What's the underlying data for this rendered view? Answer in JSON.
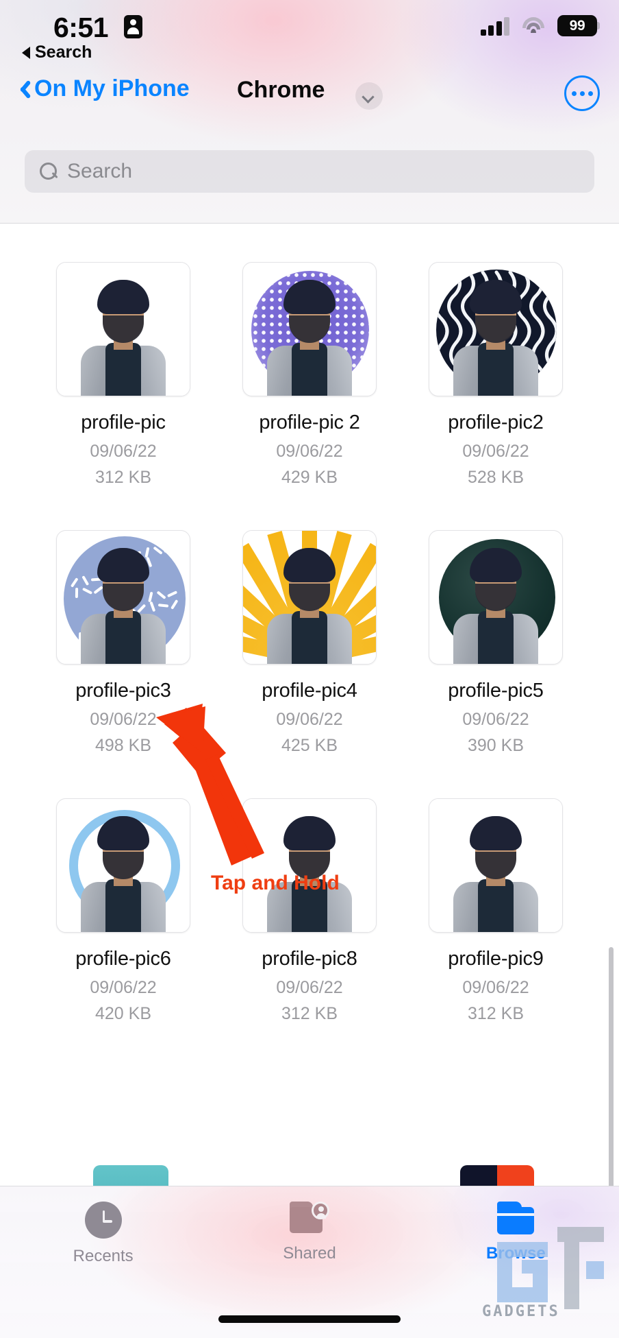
{
  "status_bar": {
    "time": "6:51",
    "recording_icon": "id-card-icon",
    "cellular_icon": "cellular-signal-icon",
    "wifi_icon": "wifi-icon",
    "battery_percent": "99"
  },
  "back_to_app": {
    "label": "Search",
    "icon": "back-triangle-icon"
  },
  "nav": {
    "back_label": "On My iPhone",
    "back_icon": "chevron-left-icon",
    "title": "Chrome",
    "title_chevron_icon": "chevron-down-icon",
    "more_icon": "ellipsis-circle-icon",
    "accent_color": "#0a84ff"
  },
  "search": {
    "placeholder": "Search",
    "icon": "search-icon"
  },
  "files": [
    {
      "name": "profile-pic",
      "date": "09/06/22",
      "size": "312 KB",
      "style": "plain"
    },
    {
      "name": "profile-pic 2",
      "date": "09/06/22",
      "size": "429 KB",
      "style": "dots"
    },
    {
      "name": "profile-pic2",
      "date": "09/06/22",
      "size": "528 KB",
      "style": "maze"
    },
    {
      "name": "profile-pic3",
      "date": "09/06/22",
      "size": "498 KB",
      "style": "confetti"
    },
    {
      "name": "profile-pic4",
      "date": "09/06/22",
      "size": "425 KB",
      "style": "rays"
    },
    {
      "name": "profile-pic5",
      "date": "09/06/22",
      "size": "390 KB",
      "style": "dark"
    },
    {
      "name": "profile-pic6",
      "date": "09/06/22",
      "size": "420 KB",
      "style": "ring"
    },
    {
      "name": "profile-pic8",
      "date": "09/06/22",
      "size": "312 KB",
      "style": "plain"
    },
    {
      "name": "profile-pic9",
      "date": "09/06/22",
      "size": "312 KB",
      "style": "plain"
    }
  ],
  "annotation": {
    "label": "Tap and Hold",
    "color": "#ef3e12",
    "arrow_target": "profile-pic3"
  },
  "tab_bar": {
    "tabs": [
      {
        "label": "Recents",
        "icon": "clock-icon",
        "active": false
      },
      {
        "label": "Shared",
        "icon": "folder-person-icon",
        "active": false
      },
      {
        "label": "Browse",
        "icon": "folder-icon",
        "active": true
      }
    ],
    "active_color": "#0a7cff",
    "inactive_color": "#8f8a94"
  },
  "watermark": {
    "text": "GADGETS",
    "logo": "gt-logo"
  }
}
